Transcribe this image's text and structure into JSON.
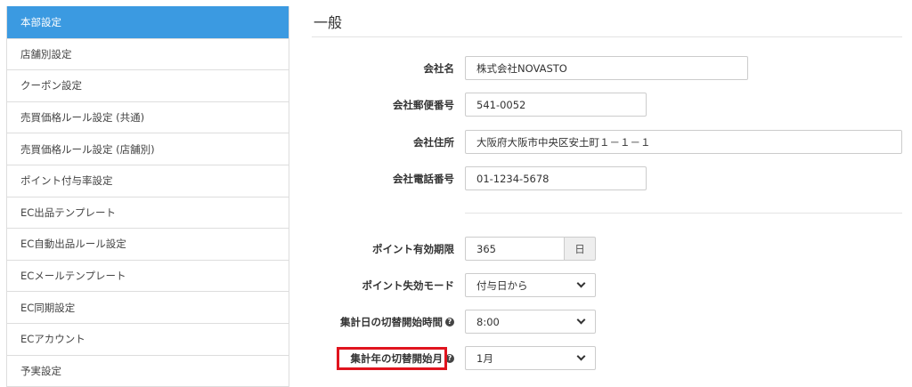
{
  "sidebar": {
    "items": [
      {
        "label": "本部設定",
        "active": true
      },
      {
        "label": "店舗別設定"
      },
      {
        "label": "クーポン設定"
      },
      {
        "label": "売買価格ルール設定 (共通)"
      },
      {
        "label": "売買価格ルール設定 (店舗別)"
      },
      {
        "label": "ポイント付与率設定"
      },
      {
        "label": "EC出品テンプレート"
      },
      {
        "label": "EC自動出品ルール設定"
      },
      {
        "label": "ECメールテンプレート"
      },
      {
        "label": "EC同期設定"
      },
      {
        "label": "ECアカウント"
      },
      {
        "label": "予実設定"
      }
    ]
  },
  "main": {
    "title": "一般",
    "company_name": {
      "label": "会社名",
      "value": "株式会社NOVASTO"
    },
    "postal_code": {
      "label": "会社郵便番号",
      "value": "541-0052"
    },
    "address": {
      "label": "会社住所",
      "value": "大阪府大阪市中央区安土町１－１－１"
    },
    "phone": {
      "label": "会社電話番号",
      "value": "01-1234-5678"
    },
    "point_expiry": {
      "label": "ポイント有効期限",
      "value": "365",
      "unit": "日"
    },
    "point_expiry_mode": {
      "label": "ポイント失効モード",
      "value": "付与日から"
    },
    "daily_switch_time": {
      "label": "集計日の切替開始時間",
      "value": "8:00",
      "help_icon": "question-circle-icon"
    },
    "yearly_switch_month": {
      "label": "集計年の切替開始月",
      "value": "1月",
      "help_icon": "question-circle-icon"
    }
  },
  "colors": {
    "active_sidebar": "#3b9ae1",
    "highlight_border": "#e0141e"
  }
}
